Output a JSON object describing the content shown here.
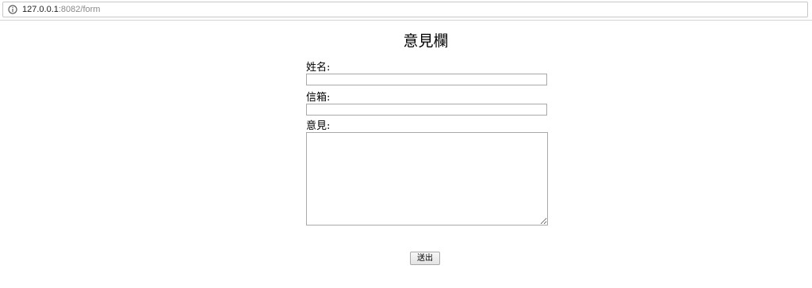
{
  "browser": {
    "url_host": "127.0.0.1",
    "url_path": ":8082/form",
    "info_icon": "info-circle-icon"
  },
  "form": {
    "title": "意見欄",
    "name_label": "姓名:",
    "name_value": "",
    "email_label": "信箱:",
    "email_value": "",
    "comment_label": "意見:",
    "comment_value": "",
    "submit_label": "送出"
  }
}
